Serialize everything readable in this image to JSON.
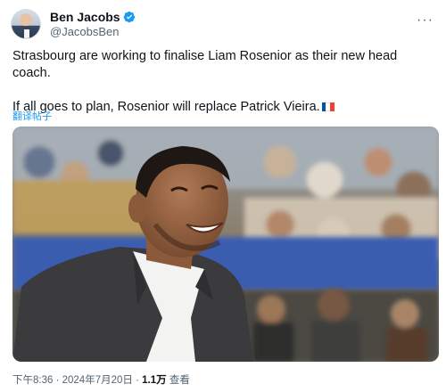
{
  "author": {
    "display_name": "Ben Jacobs",
    "handle": "@JacobsBen",
    "avatar_icon": "profile-photo-icon",
    "verified_icon": "verified-badge-icon",
    "verified_color": "#1d9bf0"
  },
  "more_icon": "ellipsis-icon",
  "tweet": {
    "line1": "Strasbourg are working to finalise Liam Rosenior as their new head coach.",
    "line2": "If all goes to plan, Rosenior will replace Patrick Vieira.",
    "flag_icon": "france-flag-icon"
  },
  "translate_label": "翻译帖子",
  "photo": {
    "icon": "coach-smiling-photo"
  },
  "footer": {
    "time": "下午8:36",
    "sep1": " · ",
    "date": "2024年7月20日",
    "sep2": " · ",
    "views_count": "1.1万",
    "views_label": " 查看"
  },
  "colors": {
    "link": "#1d9bf0",
    "muted": "#536471",
    "text": "#0f1419"
  }
}
